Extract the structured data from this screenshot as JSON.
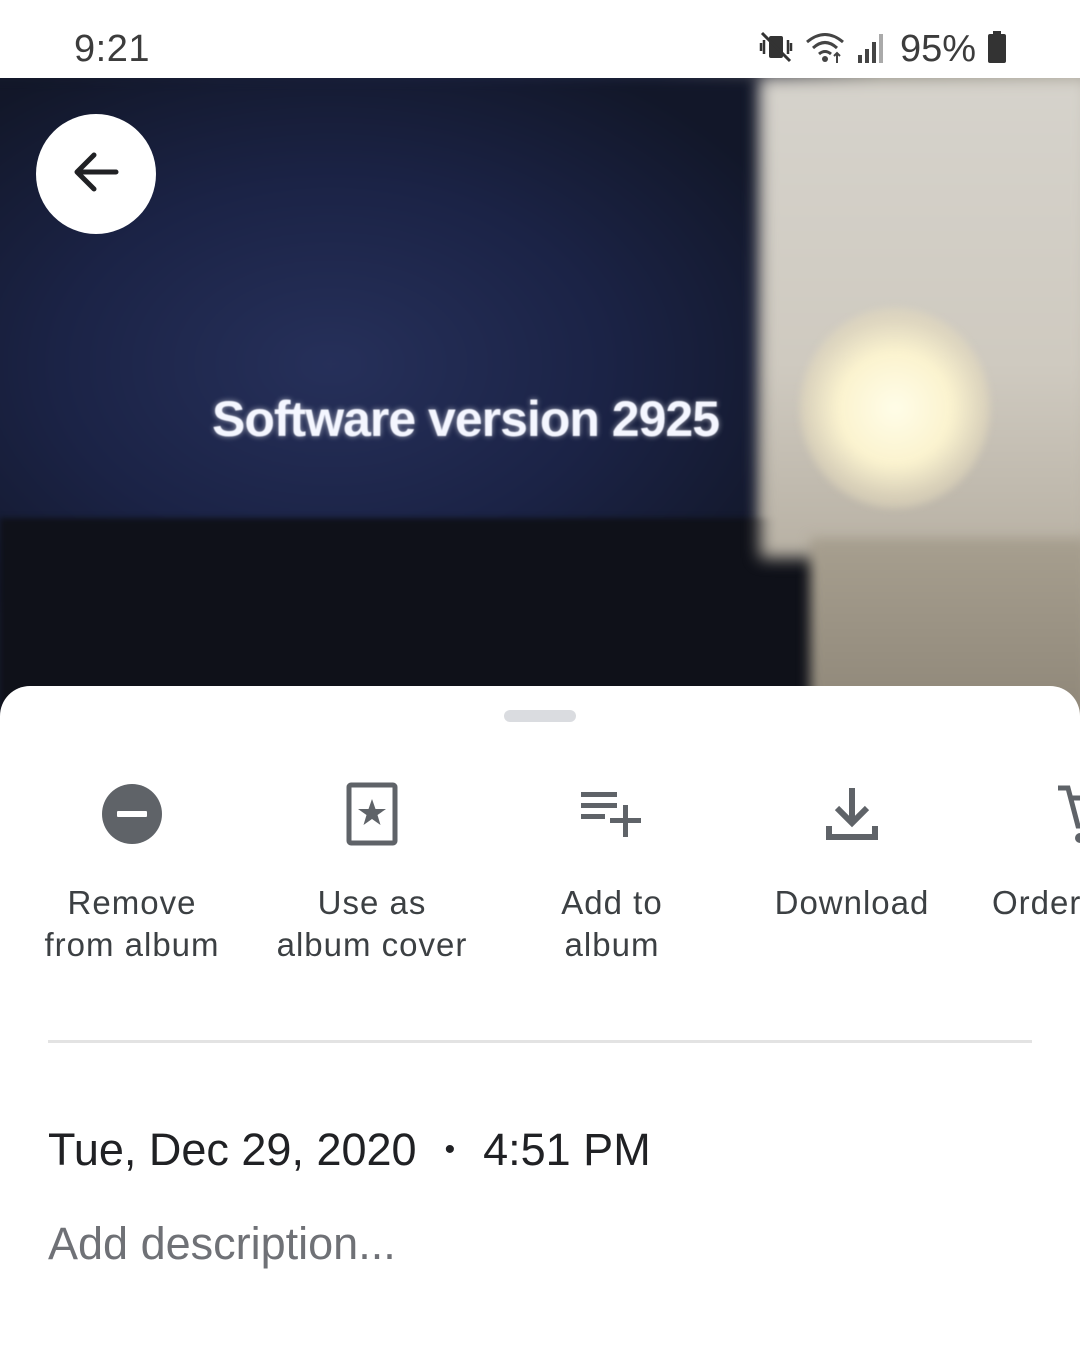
{
  "status_bar": {
    "time": "9:21",
    "battery": "95%",
    "icons": [
      "vibrate-mute-icon",
      "wifi-icon",
      "signal-icon",
      "battery-icon"
    ]
  },
  "photo": {
    "caption": "Software version 2925"
  },
  "actions": [
    {
      "label": "Remove\nfrom album",
      "icon": "remove-circle-icon"
    },
    {
      "label": "Use as\nalbum cover",
      "icon": "album-cover-star-icon"
    },
    {
      "label": "Add to\nalbum",
      "icon": "playlist-add-icon"
    },
    {
      "label": "Download",
      "icon": "download-icon"
    },
    {
      "label": "Order",
      "icon": "cart-icon"
    }
  ],
  "details": {
    "date": "Tue, Dec 29, 2020",
    "separator": "•",
    "time": "4:51 PM",
    "description_placeholder": "Add description..."
  },
  "colors": {
    "icon_gray": "#5f6368",
    "text_primary": "#202124",
    "text_secondary": "#3c4043"
  }
}
